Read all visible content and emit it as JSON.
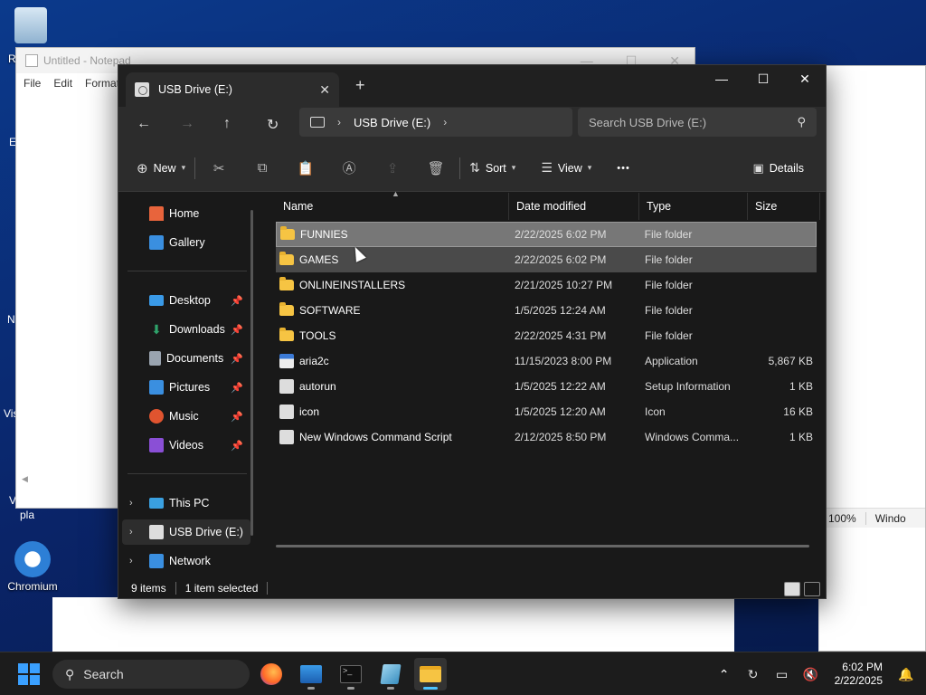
{
  "desktop": {
    "icons": [
      {
        "label": "R",
        "name": "recycle-bin"
      },
      {
        "label": "Chromium",
        "name": "chromium"
      }
    ],
    "partial_labels": [
      "E",
      "N",
      "Vis",
      "V",
      "pla"
    ]
  },
  "notepad": {
    "title": "Untitled - Notepad",
    "menu": [
      "File",
      "Edit",
      "Format"
    ]
  },
  "right_window": {
    "zoom": "100%",
    "encoding": "Windo"
  },
  "explorer": {
    "tab_title": "USB Drive (E:)",
    "new_tab": "+",
    "address": {
      "location": "USB Drive (E:)"
    },
    "search_placeholder": "Search USB Drive (E:)",
    "toolbar": {
      "new_label": "New",
      "sort_label": "Sort",
      "view_label": "View",
      "more_label": "•••",
      "details_label": "Details"
    },
    "sidebar": {
      "top": [
        {
          "label": "Home",
          "icon": "home-icon",
          "color": "#e8643c"
        },
        {
          "label": "Gallery",
          "icon": "gallery-icon",
          "color": "#3a8fe0"
        }
      ],
      "quick": [
        {
          "label": "Desktop",
          "icon": "desktop-icon",
          "color": "#3a9ae8"
        },
        {
          "label": "Downloads",
          "icon": "downloads-icon",
          "color": "#2fa36b"
        },
        {
          "label": "Documents",
          "icon": "documents-icon",
          "color": "#9aa4b0"
        },
        {
          "label": "Pictures",
          "icon": "pictures-icon",
          "color": "#3a8fe0"
        },
        {
          "label": "Music",
          "icon": "music-icon",
          "color": "#e0542f"
        },
        {
          "label": "Videos",
          "icon": "videos-icon",
          "color": "#8a4fd6"
        }
      ],
      "drives": [
        {
          "label": "This PC",
          "icon": "pc-icon",
          "color": "#3aa0e0"
        },
        {
          "label": "USB Drive (E:)",
          "icon": "usb-drive-icon",
          "color": "#dddddd"
        },
        {
          "label": "Network",
          "icon": "network-icon",
          "color": "#3a8fe0"
        }
      ]
    },
    "columns": [
      "Name",
      "Date modified",
      "Type",
      "Size"
    ],
    "files": [
      {
        "name": "FUNNIES",
        "date": "2/22/2025 6:02 PM",
        "type": "File folder",
        "size": "",
        "kind": "folder"
      },
      {
        "name": "GAMES",
        "date": "2/22/2025 6:02 PM",
        "type": "File folder",
        "size": "",
        "kind": "folder"
      },
      {
        "name": "ONLINEINSTALLERS",
        "date": "2/21/2025 10:27 PM",
        "type": "File folder",
        "size": "",
        "kind": "folder"
      },
      {
        "name": "SOFTWARE",
        "date": "1/5/2025 12:24 AM",
        "type": "File folder",
        "size": "",
        "kind": "folder"
      },
      {
        "name": "TOOLS",
        "date": "2/22/2025 4:31 PM",
        "type": "File folder",
        "size": "",
        "kind": "folder"
      },
      {
        "name": "aria2c",
        "date": "11/15/2023 8:00 PM",
        "type": "Application",
        "size": "5,867 KB",
        "kind": "app"
      },
      {
        "name": "autorun",
        "date": "1/5/2025 12:22 AM",
        "type": "Setup Information",
        "size": "1 KB",
        "kind": "file"
      },
      {
        "name": "icon",
        "date": "1/5/2025 12:20 AM",
        "type": "Icon",
        "size": "16 KB",
        "kind": "file"
      },
      {
        "name": "New Windows Command Script",
        "date": "2/12/2025 8:50 PM",
        "type": "Windows Comma...",
        "size": "1 KB",
        "kind": "file"
      }
    ],
    "status": {
      "count": "9 items",
      "selection": "1 item selected"
    }
  },
  "taskbar": {
    "search_label": "Search",
    "time": "6:02 PM",
    "date": "2/22/2025"
  }
}
